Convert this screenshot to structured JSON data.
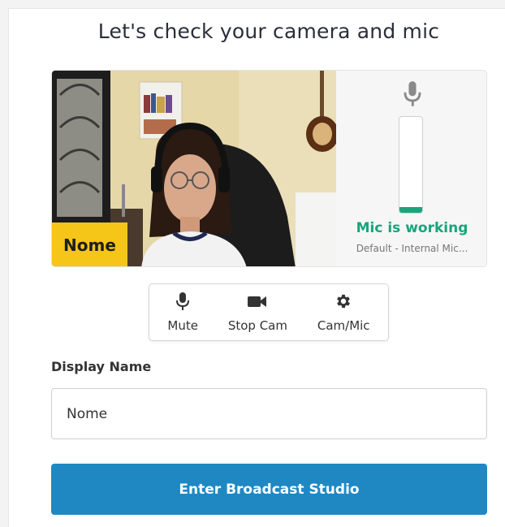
{
  "page": {
    "title": "Let's check your camera and mic"
  },
  "camera": {
    "name_tag": "Nome"
  },
  "mic": {
    "status": "Mic is working",
    "device": "Default - Internal Mic...",
    "level_fraction": 0.06,
    "status_color": "#1aa47c"
  },
  "controls": {
    "mute_label": "Mute",
    "stop_cam_label": "Stop Cam",
    "settings_label": "Cam/Mic"
  },
  "display_name": {
    "label": "Display Name",
    "value": "Nome"
  },
  "enter_button": {
    "label": "Enter Broadcast Studio",
    "color": "#1f88c3"
  },
  "icons": [
    "microphone-icon",
    "video-camera-icon",
    "gear-icon"
  ]
}
